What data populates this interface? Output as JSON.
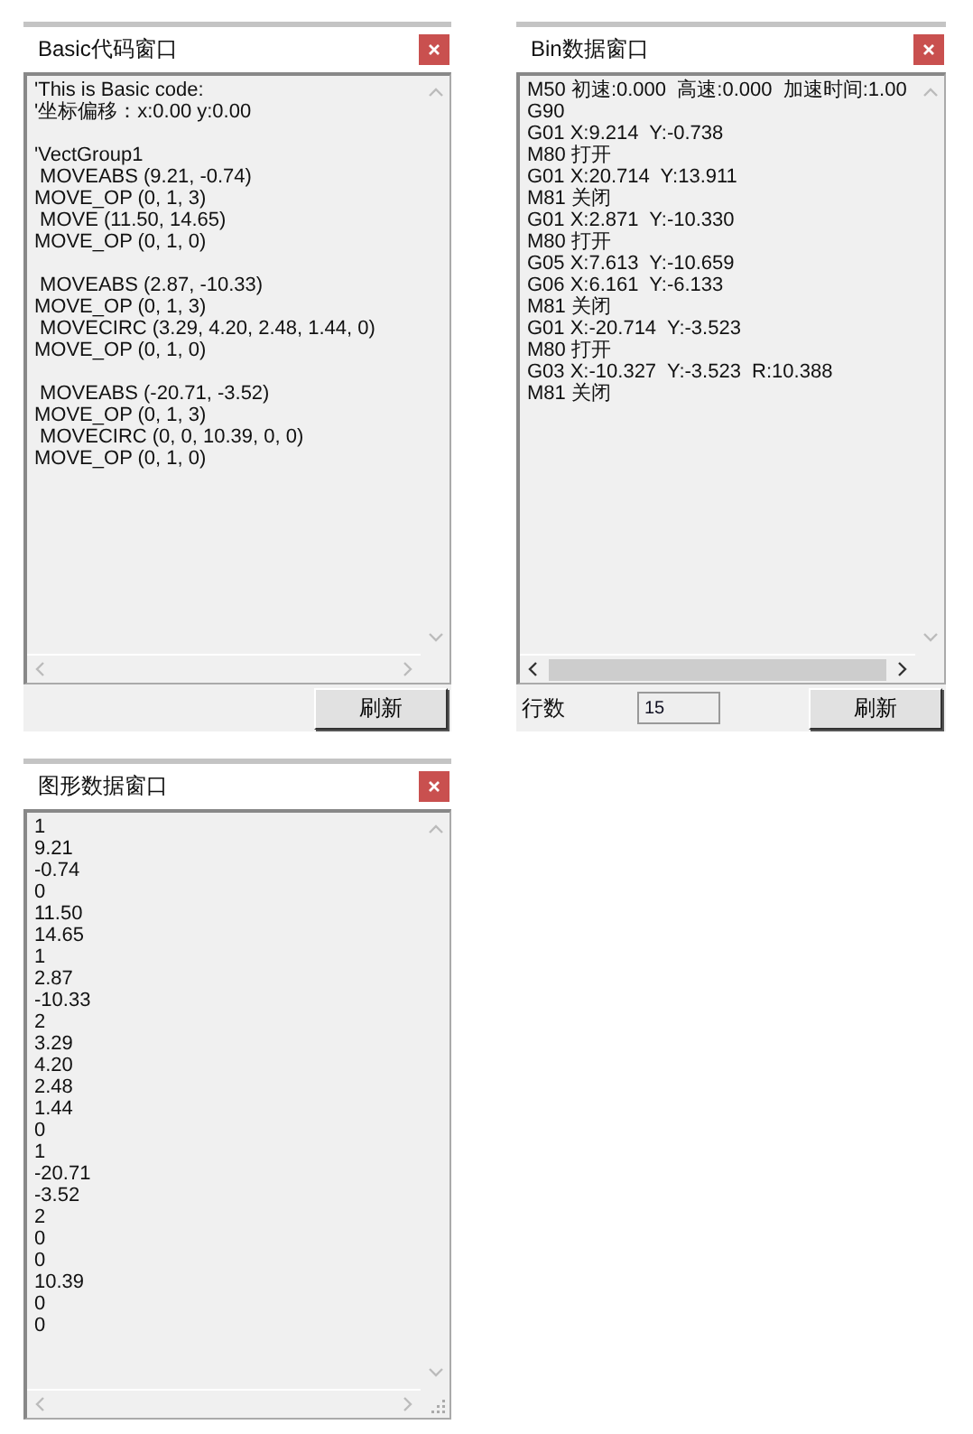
{
  "windows": [
    {
      "title": "Basic代码窗口",
      "blocks": [
        [
          "'This is Basic code:",
          "'坐标偏移：x:0.00 y:0.00"
        ],
        [
          "'VectGroup1",
          " MOVEABS (9.21, -0.74)",
          "MOVE_OP (0, 1, 3)",
          " MOVE (11.50, 14.65)",
          "MOVE_OP (0, 1, 0)"
        ],
        [
          " MOVEABS (2.87, -10.33)",
          "MOVE_OP (0, 1, 3)",
          " MOVECIRC (3.29, 4.20, 2.48, 1.44, 0)",
          "MOVE_OP (0, 1, 0)"
        ],
        [
          " MOVEABS (-20.71, -3.52)",
          "MOVE_OP (0, 1, 3)",
          " MOVECIRC (0, 0, 10.39, 0, 0)",
          "MOVE_OP (0, 1, 0)"
        ]
      ],
      "h_scroll_thumb": false,
      "size_grip": false,
      "footer": {
        "button": "刷新"
      }
    },
    {
      "title": "Bin数据窗口",
      "blocks": [
        [
          "M50 初速:0.000  高速:0.000  加速时间:1.00",
          "G90",
          "G01 X:9.214  Y:-0.738",
          "M80 打开",
          "G01 X:20.714  Y:13.911",
          "M81 关闭",
          "G01 X:2.871  Y:-10.330",
          "M80 打开",
          "G05 X:7.613  Y:-10.659",
          "G06 X:6.161  Y:-6.133",
          "M81 关闭",
          "G01 X:-20.714  Y:-3.523",
          "M80 打开",
          "G03 X:-10.327  Y:-3.523  R:10.388",
          "M81 关闭"
        ]
      ],
      "h_scroll_thumb": true,
      "size_grip": false,
      "footer": {
        "label": "行数",
        "field_value": "15",
        "button": "刷新"
      }
    },
    {
      "title": "图形数据窗口",
      "blocks": [
        [
          "1",
          "9.21",
          "-0.74",
          "0",
          "11.50",
          "14.65",
          "1",
          "2.87",
          "-10.33",
          "2",
          "3.29",
          "4.20",
          "2.48",
          "1.44",
          "0",
          "1",
          "-20.71",
          "-3.52",
          "2",
          "0",
          "0",
          "10.39",
          "0",
          "0"
        ]
      ],
      "h_scroll_thumb": false,
      "size_grip": true
    }
  ]
}
